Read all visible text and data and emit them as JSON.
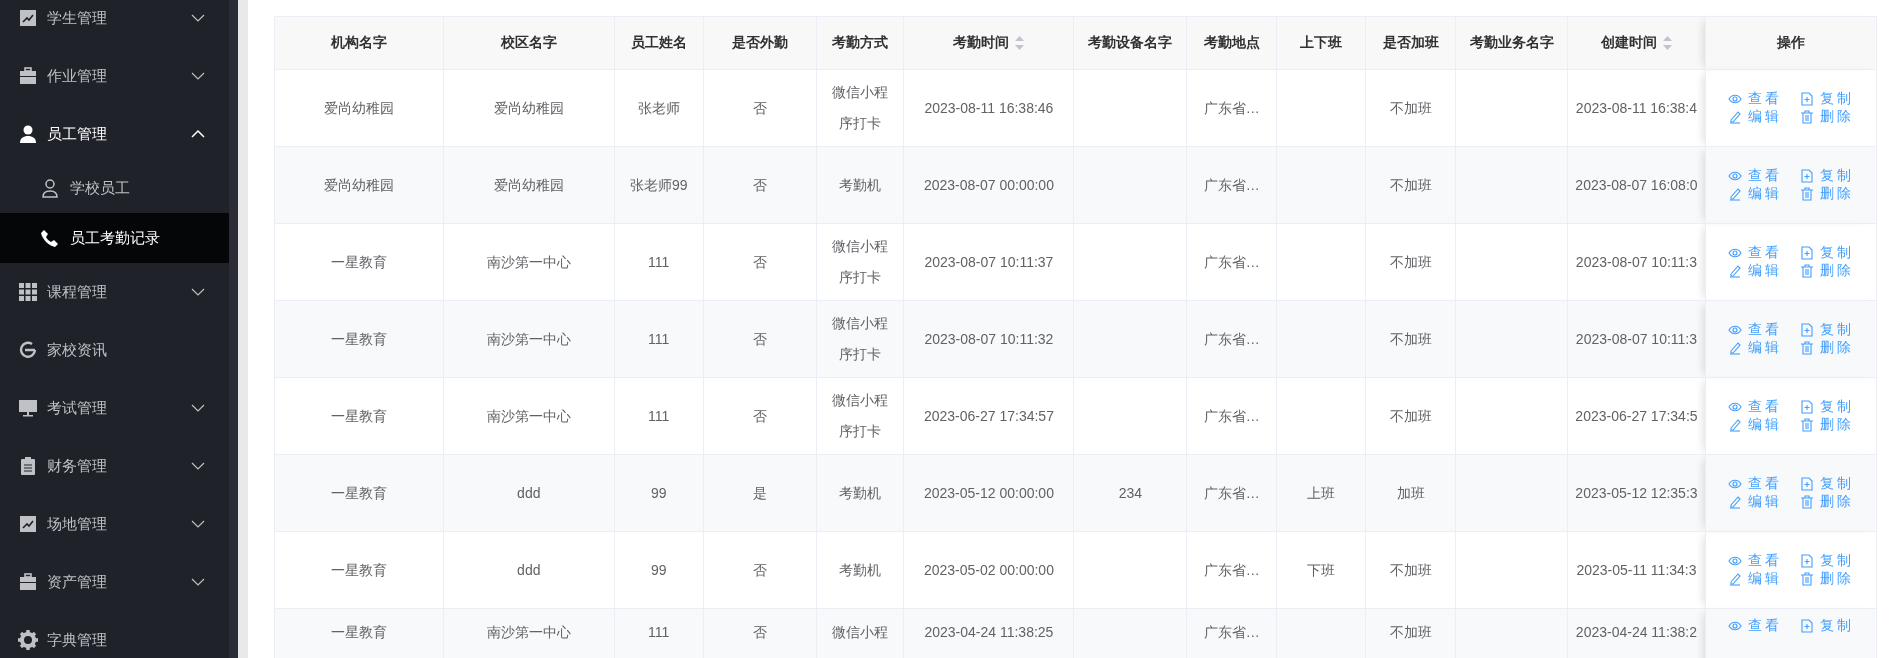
{
  "sidebar": {
    "items": [
      {
        "label": "学生管理",
        "expanded": false
      },
      {
        "label": "作业管理",
        "expanded": false
      },
      {
        "label": "员工管理",
        "expanded": true,
        "children": [
          {
            "label": "学校员工",
            "selected": false
          },
          {
            "label": "员工考勤记录",
            "selected": true
          }
        ]
      },
      {
        "label": "课程管理",
        "expanded": false
      },
      {
        "label": "家校资讯"
      },
      {
        "label": "考试管理",
        "expanded": false
      },
      {
        "label": "财务管理",
        "expanded": false
      },
      {
        "label": "场地管理",
        "expanded": false
      },
      {
        "label": "资产管理",
        "expanded": false
      },
      {
        "label": "字典管理"
      }
    ]
  },
  "table": {
    "columns": [
      {
        "label": "机构名字",
        "sortable": false
      },
      {
        "label": "校区名字",
        "sortable": false
      },
      {
        "label": "员工姓名",
        "sortable": false
      },
      {
        "label": "是否外勤",
        "sortable": false
      },
      {
        "label": "考勤方式",
        "sortable": false
      },
      {
        "label": "考勤时间",
        "sortable": true
      },
      {
        "label": "考勤设备名字",
        "sortable": false
      },
      {
        "label": "考勤地点",
        "sortable": false
      },
      {
        "label": "上下班",
        "sortable": false
      },
      {
        "label": "是否加班",
        "sortable": false
      },
      {
        "label": "考勤业务名字",
        "sortable": false
      },
      {
        "label": "创建时间",
        "sortable": true
      },
      {
        "label": "操作",
        "sortable": false
      }
    ],
    "rows": [
      {
        "cells": [
          "爱尚幼稚园",
          "爱尚幼稚园",
          "张老师",
          "否",
          "微信小程序打卡",
          "2023-08-11 16:38:46",
          "",
          "广东省…",
          "",
          "不加班",
          "",
          "2023-08-11 16:38:4"
        ],
        "actions": [
          {
            "label": "查看",
            "kind": "view"
          },
          {
            "label": "复制",
            "kind": "copy"
          },
          {
            "label": "编辑",
            "kind": "edit"
          },
          {
            "label": "删除",
            "kind": "delete"
          }
        ]
      },
      {
        "cells": [
          "爱尚幼稚园",
          "爱尚幼稚园",
          "张老师99",
          "否",
          "考勤机",
          "2023-08-07 00:00:00",
          "",
          "广东省…",
          "",
          "不加班",
          "",
          "2023-08-07 16:08:0"
        ],
        "actions": [
          {
            "label": "查看",
            "kind": "view"
          },
          {
            "label": "复制",
            "kind": "copy"
          },
          {
            "label": "编辑",
            "kind": "edit"
          },
          {
            "label": "删除",
            "kind": "delete"
          }
        ]
      },
      {
        "cells": [
          "一星教育",
          "南沙第一中心",
          "111",
          "否",
          "微信小程序打卡",
          "2023-08-07 10:11:37",
          "",
          "广东省…",
          "",
          "不加班",
          "",
          "2023-08-07 10:11:3"
        ],
        "actions": [
          {
            "label": "查看",
            "kind": "view"
          },
          {
            "label": "复制",
            "kind": "copy"
          },
          {
            "label": "编辑",
            "kind": "edit"
          },
          {
            "label": "删除",
            "kind": "delete"
          }
        ]
      },
      {
        "cells": [
          "一星教育",
          "南沙第一中心",
          "111",
          "否",
          "微信小程序打卡",
          "2023-08-07 10:11:32",
          "",
          "广东省…",
          "",
          "不加班",
          "",
          "2023-08-07 10:11:3"
        ],
        "actions": [
          {
            "label": "查看",
            "kind": "view"
          },
          {
            "label": "复制",
            "kind": "copy"
          },
          {
            "label": "编辑",
            "kind": "edit"
          },
          {
            "label": "删除",
            "kind": "delete"
          }
        ]
      },
      {
        "cells": [
          "一星教育",
          "南沙第一中心",
          "111",
          "否",
          "微信小程序打卡",
          "2023-06-27 17:34:57",
          "",
          "广东省…",
          "",
          "不加班",
          "",
          "2023-06-27 17:34:5"
        ],
        "actions": [
          {
            "label": "查看",
            "kind": "view"
          },
          {
            "label": "复制",
            "kind": "copy"
          },
          {
            "label": "编辑",
            "kind": "edit"
          },
          {
            "label": "删除",
            "kind": "delete"
          }
        ]
      },
      {
        "cells": [
          "一星教育",
          "ddd",
          "99",
          "是",
          "考勤机",
          "2023-05-12 00:00:00",
          "234",
          "广东省…",
          "上班",
          "加班",
          "",
          "2023-05-12 12:35:3"
        ],
        "actions": [
          {
            "label": "查看",
            "kind": "view"
          },
          {
            "label": "复制",
            "kind": "copy"
          },
          {
            "label": "编辑",
            "kind": "edit"
          },
          {
            "label": "删除",
            "kind": "delete"
          }
        ]
      },
      {
        "cells": [
          "一星教育",
          "ddd",
          "99",
          "否",
          "考勤机",
          "2023-05-02 00:00:00",
          "",
          "广东省…",
          "下班",
          "不加班",
          "",
          "2023-05-11 11:34:3"
        ],
        "actions": [
          {
            "label": "查看",
            "kind": "view"
          },
          {
            "label": "复制",
            "kind": "copy"
          },
          {
            "label": "编辑",
            "kind": "edit"
          },
          {
            "label": "删除",
            "kind": "delete"
          }
        ]
      },
      {
        "cells": [
          "一星教育",
          "南沙第一中心",
          "111",
          "否",
          "微信小程",
          "2023-04-24 11:38:25",
          "",
          "广东省…",
          "",
          "不加班",
          "",
          "2023-04-24 11:38:2"
        ],
        "actions": [
          {
            "label": "查看",
            "kind": "view"
          },
          {
            "label": "复制",
            "kind": "copy"
          }
        ]
      }
    ]
  }
}
